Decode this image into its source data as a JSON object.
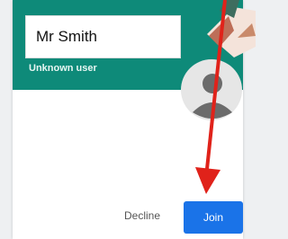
{
  "invite": {
    "caller_name": "Mr Smith",
    "caller_status": "Unknown user"
  },
  "actions": {
    "decline_label": "Decline",
    "join_label": "Join"
  },
  "icons": {
    "avatar": "user-avatar-icon",
    "annotation": "red-arrow-icon"
  },
  "colors": {
    "header": "#0e8a79",
    "join_button": "#1a73e8",
    "annotation_arrow": "#e0221a"
  }
}
